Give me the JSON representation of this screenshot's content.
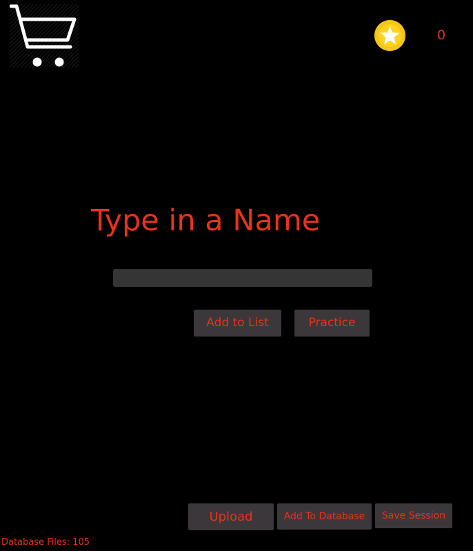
{
  "header": {
    "cart_icon": "shopping-cart-icon",
    "star_icon": "star-coin-icon",
    "coin_count": "0"
  },
  "main": {
    "title": "Type in a Name",
    "name_input": {
      "value": "",
      "placeholder": ""
    },
    "add_to_list_label": "Add to List",
    "practice_label": "Practice"
  },
  "footer": {
    "upload_label": "Upload",
    "add_to_database_label": "Add To Database",
    "save_session_label": "Save Session",
    "database_files_text": "Database Files: 105"
  },
  "colors": {
    "background": "#000000",
    "accent_text": "#e8331a",
    "button_background": "#3c373b",
    "input_background": "#353535",
    "star_coin": "#f5c518",
    "cart_icon": "#ffffff"
  }
}
